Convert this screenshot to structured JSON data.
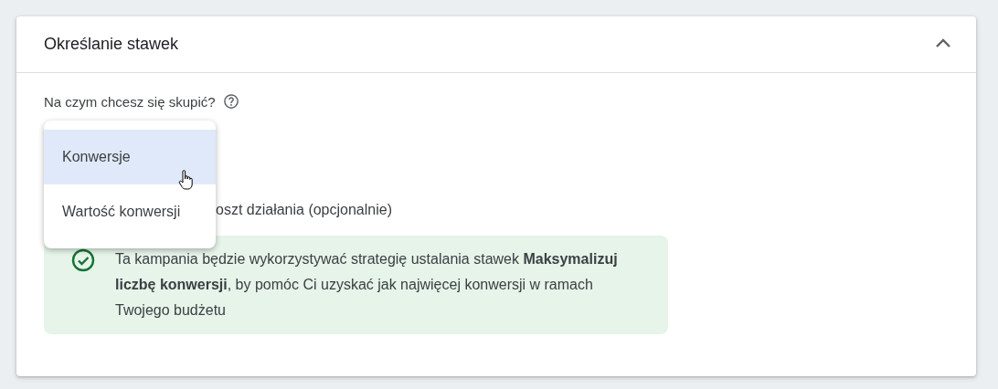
{
  "card": {
    "title": "Określanie stawek",
    "expanded": true
  },
  "focus": {
    "label": "Na czym chcesz się skupić?"
  },
  "menu": {
    "items": [
      {
        "label": "Konwersje",
        "selected": true
      },
      {
        "label": "Wartość konwersji",
        "selected": false
      }
    ]
  },
  "target_cost": {
    "label": "oszt działania (opcjonalnie)"
  },
  "notice": {
    "text": "Ta kampania będzie wykorzystywać strategię ustalania stawek **Maksymalizuj liczbę konwersji**, by pomóc Ci uzyskać jak najwięcej konwersji w ramach Twojego budżetu"
  }
}
